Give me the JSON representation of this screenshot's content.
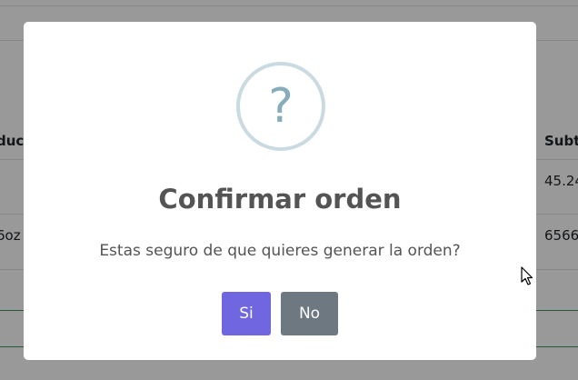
{
  "background_table": {
    "header_left": "duc",
    "header_right": "Subt",
    "row1_right": "45.24",
    "row2_left": "6oz",
    "row2_right": "6566"
  },
  "dialog": {
    "icon": "question-icon",
    "icon_glyph": "?",
    "title": "Confirmar orden",
    "text": "Estas seguro de que quieres generar la orden?",
    "confirm_label": "Si",
    "cancel_label": "No"
  },
  "colors": {
    "confirm": "#7066e0",
    "cancel": "#6e7881",
    "icon": "#87adbd"
  }
}
